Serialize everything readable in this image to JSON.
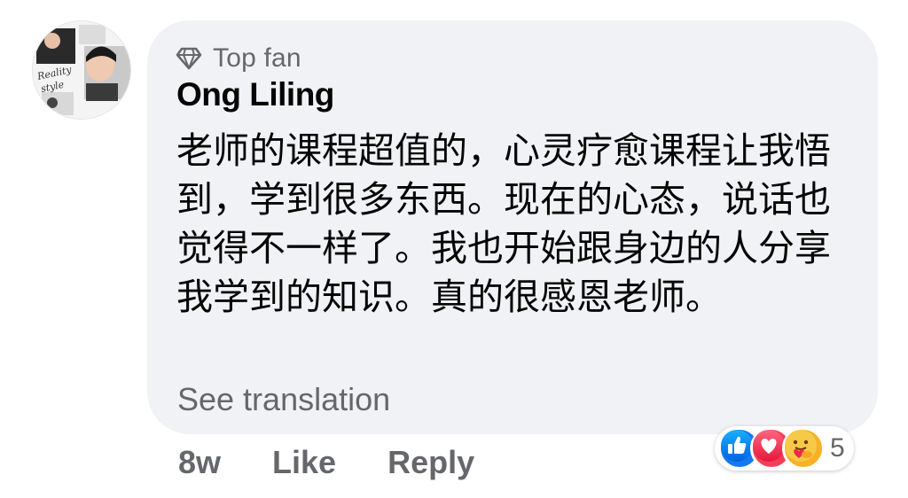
{
  "comment": {
    "badge": {
      "icon": "diamond-icon",
      "label": "Top fan"
    },
    "author": "Ong Liling",
    "text": "老师的课程超值的，心灵疗愈课程让我悟到，学到很多东西。现在的心态，说话也觉得不一样了。我也开始跟身边的人分享我学到的知识。真的很感恩老师。",
    "see_translation": "See translation",
    "avatar_text": "Reality style"
  },
  "actions": {
    "time": "8w",
    "like": "Like",
    "reply": "Reply"
  },
  "reactions": {
    "icons": [
      "like-reaction-icon",
      "love-reaction-icon",
      "care-reaction-icon"
    ],
    "count": "5"
  },
  "colors": {
    "bubble_bg": "#f0f2f5",
    "secondary_text": "#65676b",
    "primary_text": "#050505",
    "like_blue": "#1877f2",
    "love_red": "#f33e58",
    "care_yellow": "#f7b125"
  }
}
